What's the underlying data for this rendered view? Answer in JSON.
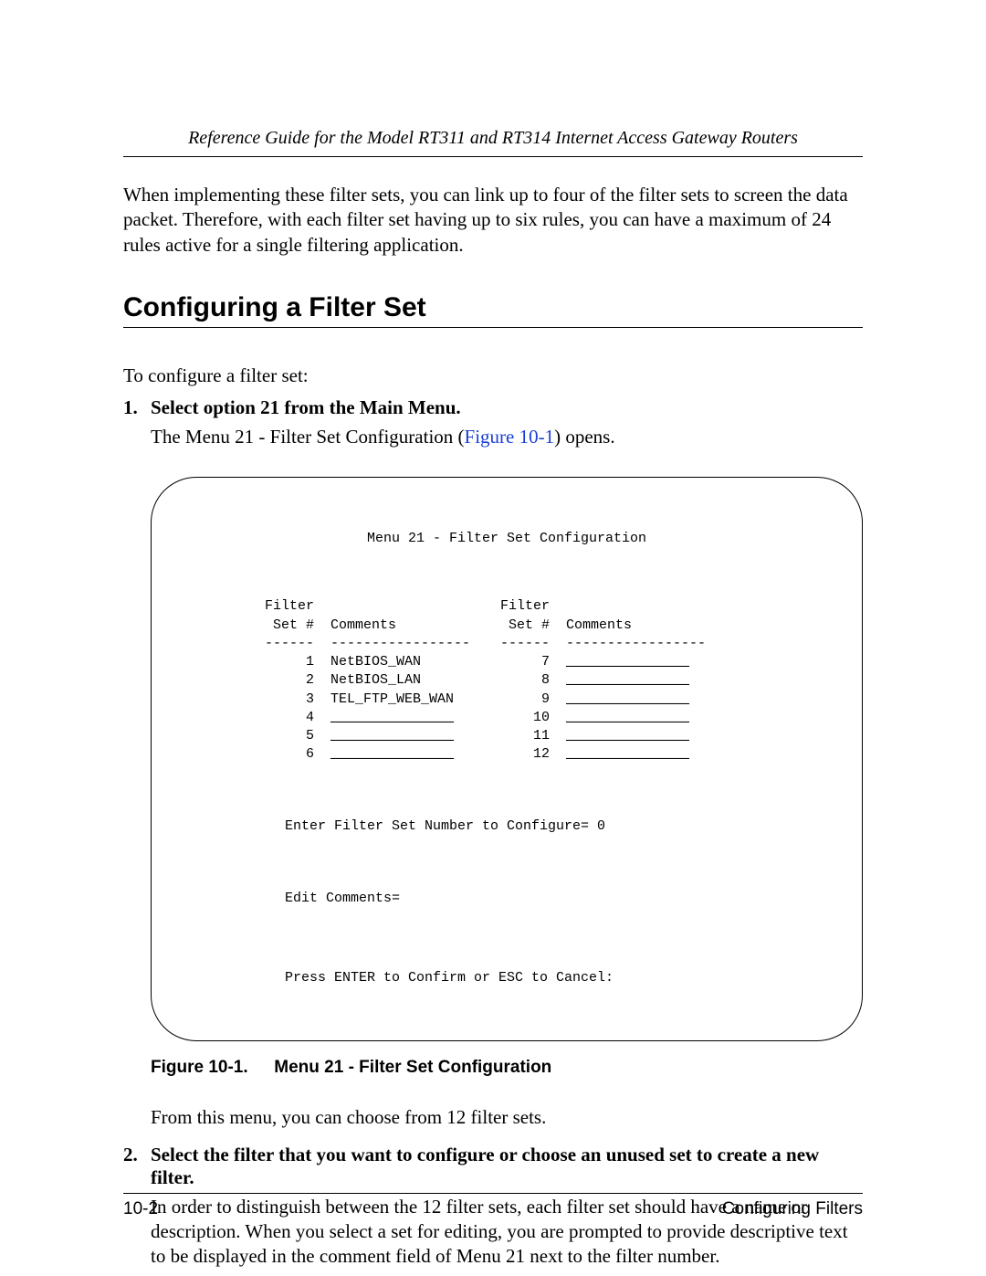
{
  "header": {
    "running_title": "Reference Guide for the Model RT311 and RT314 Internet Access Gateway Routers"
  },
  "intro_para": "When implementing these filter sets, you can link up to four of the filter sets to screen the data packet. Therefore, with each filter set having up to six rules, you can have a maximum of 24 rules active for a single filtering application.",
  "section_heading": "Configuring a Filter Set",
  "lead": "To configure a filter set:",
  "steps": [
    {
      "head": "Select option 21 from the Main Menu.",
      "body_pre": "The Menu 21 - Filter Set Configuration (",
      "body_link": "Figure 10-1",
      "body_post": ") opens.",
      "after_figure": "From this menu, you can choose from 12 filter sets."
    },
    {
      "head": "Select the filter that you want to configure or choose an unused set to create a new filter.",
      "body": "In order to distinguish between the 12 filter sets, each filter set should have a name or description. When you select a set for editing, you are prompted to provide descriptive text to be displayed in the comment field of Menu 21 next to the filter number."
    }
  ],
  "terminal": {
    "title": "Menu 21 - Filter Set Configuration",
    "col_header_left_1": "Filter",
    "col_header_left_2": "Set #",
    "col_header_left_3": "Comments",
    "col_header_right_1": "Filter",
    "col_header_right_2": "Set #",
    "col_header_right_3": "Comments",
    "divider_short": "------",
    "divider_long": "-----------------",
    "blank": "_______________",
    "rows": [
      {
        "l": "1",
        "lc": "NetBIOS_WAN",
        "r": "7",
        "rc": ""
      },
      {
        "l": "2",
        "lc": "NetBIOS_LAN",
        "r": "8",
        "rc": ""
      },
      {
        "l": "3",
        "lc": "TEL_FTP_WEB_WAN",
        "r": "9",
        "rc": ""
      },
      {
        "l": "4",
        "lc": "",
        "r": "10",
        "rc": ""
      },
      {
        "l": "5",
        "lc": "",
        "r": "11",
        "rc": ""
      },
      {
        "l": "6",
        "lc": "",
        "r": "12",
        "rc": ""
      }
    ],
    "prompt1": "Enter Filter Set Number to Configure= 0",
    "prompt2": "Edit Comments=",
    "prompt3": "Press ENTER to Confirm or ESC to Cancel:"
  },
  "figure": {
    "num": "Figure 10-1.",
    "title": "Menu 21 - Filter Set Configuration"
  },
  "footer": {
    "page": "10-2",
    "section": "Configuring Filters"
  }
}
